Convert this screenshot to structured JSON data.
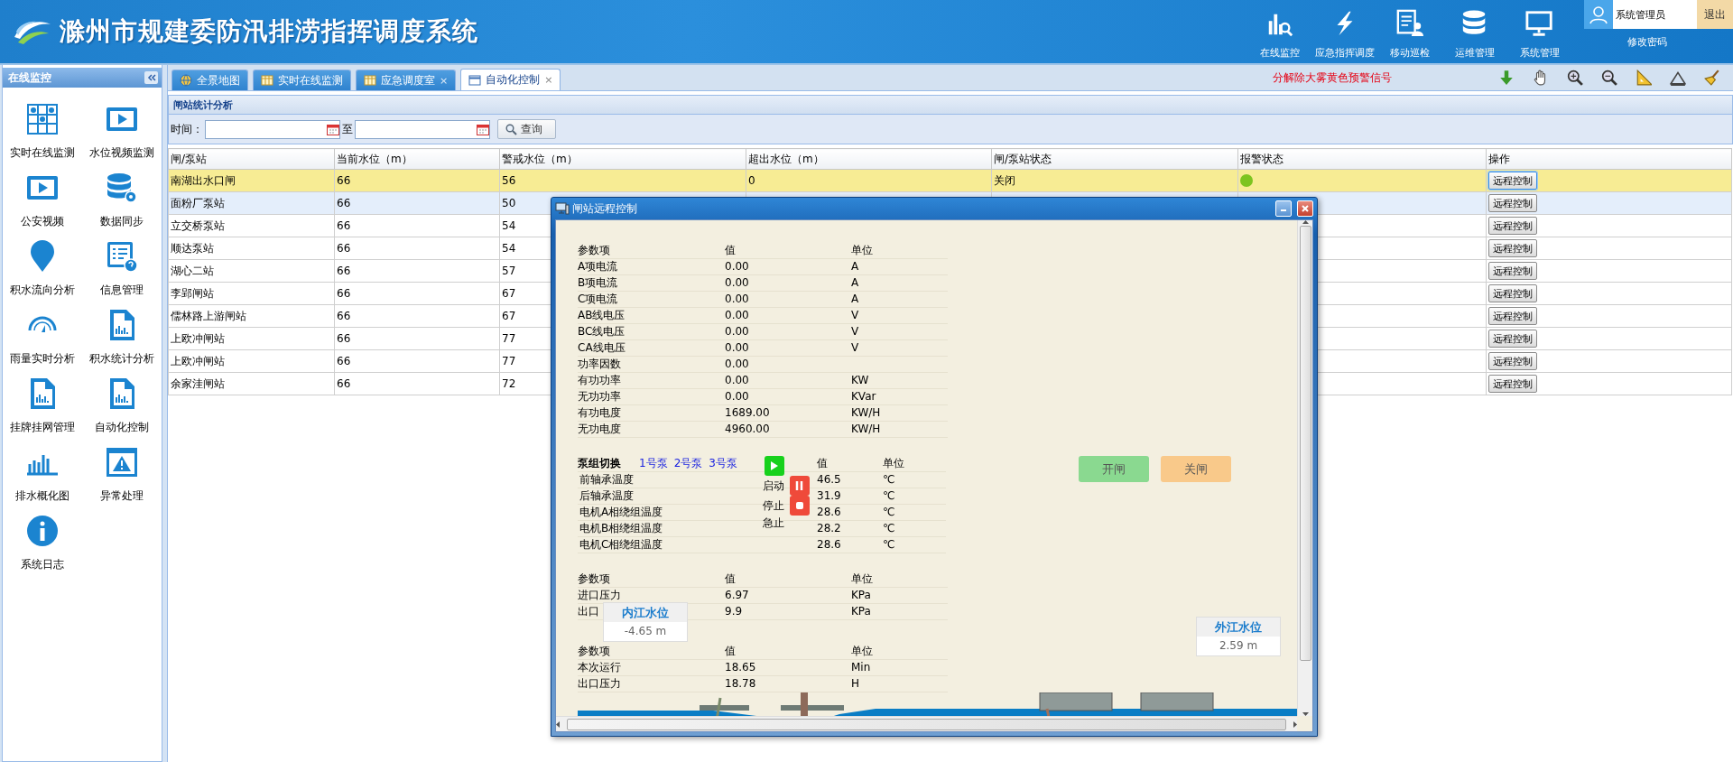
{
  "header": {
    "title": "滁州市规建委防汛排涝指挥调度系统",
    "nav": [
      {
        "label": "在线监控"
      },
      {
        "label": "应急指挥调度"
      },
      {
        "label": "移动巡检"
      },
      {
        "label": "运维管理"
      },
      {
        "label": "系统管理"
      }
    ],
    "user": {
      "name": "系统管理员",
      "logout": "退出",
      "change_password": "修改密码"
    }
  },
  "sidebar": {
    "title": "在线监控",
    "items": [
      {
        "label": "实时在线监测"
      },
      {
        "label": "水位视频监测"
      },
      {
        "label": "公安视频"
      },
      {
        "label": "数据同步"
      },
      {
        "label": "积水流向分析"
      },
      {
        "label": "信息管理"
      },
      {
        "label": "雨量实时分析"
      },
      {
        "label": "积水统计分析"
      },
      {
        "label": "挂牌挂网管理"
      },
      {
        "label": "自动化控制"
      },
      {
        "label": "排水概化图"
      },
      {
        "label": "异常处理"
      },
      {
        "label": "系统日志"
      }
    ]
  },
  "tabs": [
    {
      "label": "全景地图",
      "selected": false
    },
    {
      "label": "实时在线监测",
      "selected": false
    },
    {
      "label": "应急调度室",
      "close": "×",
      "selected": false
    },
    {
      "label": "自动化控制",
      "close": "×",
      "selected": true
    }
  ],
  "notice": "分解除大雾黄色预警信号",
  "panel": {
    "title": "闸站统计分析",
    "filter": {
      "label": "时间：",
      "separator": "至",
      "button": "查询"
    }
  },
  "table": {
    "columns": [
      "闸/泵站",
      "当前水位（m）",
      "警戒水位（m）",
      "超出水位（m）",
      "闸/泵站状态",
      "报警状态",
      "操作"
    ],
    "rows": [
      {
        "cells": [
          "南湖出水口闸",
          "66",
          "56",
          "0",
          "关闭"
        ],
        "color": "#7dc41f",
        "action": "远程控制",
        "selected": true,
        "highlighted": false
      },
      {
        "cells": [
          "面粉厂泵站",
          "66",
          "50"
        ],
        "action": "远程控制",
        "selected": false,
        "highlighted": true
      },
      {
        "cells": [
          "立交桥泵站",
          "66",
          "54"
        ],
        "action": "远程控制",
        "selected": false,
        "highlighted": false
      },
      {
        "cells": [
          "顺达泵站",
          "66",
          "54"
        ],
        "action": "远程控制",
        "selected": false,
        "highlighted": false
      },
      {
        "cells": [
          "湖心二站",
          "66",
          "57"
        ],
        "action": "远程控制",
        "selected": false,
        "highlighted": false
      },
      {
        "cells": [
          "李郢闸站",
          "66",
          "67"
        ],
        "action": "远程控制",
        "selected": false,
        "highlighted": false
      },
      {
        "cells": [
          "儒林路上游闸站",
          "66",
          "67"
        ],
        "action": "远程控制",
        "selected": false,
        "highlighted": false
      },
      {
        "cells": [
          "上欧冲闸站",
          "66",
          "77"
        ],
        "action": "远程控制",
        "selected": false,
        "highlighted": false
      },
      {
        "cells": [
          "上欧冲闸站",
          "66",
          "77"
        ],
        "action": "远程控制",
        "selected": false,
        "highlighted": false
      },
      {
        "cells": [
          "余家洼闸站",
          "66",
          "72"
        ],
        "action": "远程控制",
        "selected": false,
        "highlighted": false
      }
    ]
  },
  "dialog": {
    "title": "闸站远程控制",
    "electric": {
      "columns": [
        "参数项",
        "值",
        "单位"
      ],
      "rows": [
        [
          "A项电流",
          "0.00",
          "A"
        ],
        [
          "B项电流",
          "0.00",
          "A"
        ],
        [
          "C项电流",
          "0.00",
          "A"
        ],
        [
          "AB线电压",
          "0.00",
          "V"
        ],
        [
          "BC线电压",
          "0.00",
          "V"
        ],
        [
          "CA线电压",
          "0.00",
          "V"
        ],
        [
          "功率因数",
          "0.00"
        ],
        [
          "有功功率",
          "0.00",
          "KW"
        ],
        [
          "无功功率",
          "0.00",
          "KVar"
        ],
        [
          "有功电度",
          "1689.00",
          "KW/H"
        ],
        [
          "无功电度",
          "4960.00",
          "KW/H"
        ]
      ]
    },
    "pump": {
      "pumps": [
        {
          "label": "1号泵"
        },
        {
          "label": "2号泵"
        },
        {
          "label": "3号泵"
        }
      ],
      "columns": [
        "泵组切换",
        "值",
        "单位"
      ],
      "buttons": [
        {
          "kind": "play"
        },
        {
          "kind": "pause"
        },
        {
          "kind": "stop"
        }
      ],
      "button_labels": [
        "启动",
        "停止",
        "急止"
      ],
      "rows": [
        [
          "前轴承温度",
          "46.5",
          "℃"
        ],
        [
          "后轴承温度",
          "31.9",
          "℃"
        ],
        [
          "电机A相绕组温度",
          "28.6",
          "℃"
        ],
        [
          "电机B相绕组温度",
          "28.2",
          "℃"
        ],
        [
          "电机C相绕组温度",
          "28.6",
          "℃"
        ]
      ]
    },
    "pressure": {
      "columns": [
        "参数项",
        "值",
        "单位"
      ],
      "rows": [
        [
          "进口压力",
          "6.97",
          "KPa"
        ],
        [
          "出口",
          "9.9",
          "KPa"
        ]
      ]
    },
    "runtime": {
      "columns": [
        "参数项",
        "值",
        "单位"
      ],
      "rows": [
        [
          "本次运行",
          "18.65",
          "Min"
        ],
        [
          "出口压力",
          "18.78",
          "H"
        ]
      ]
    },
    "gate_buttons": [
      {
        "kind": "open",
        "label": "开闸"
      },
      {
        "kind": "close",
        "label": "关闸"
      }
    ],
    "levels": [
      {
        "label": "内江水位",
        "value": "-4.65 m"
      },
      {
        "label": "外江水位",
        "value": "2.59 m"
      }
    ]
  }
}
